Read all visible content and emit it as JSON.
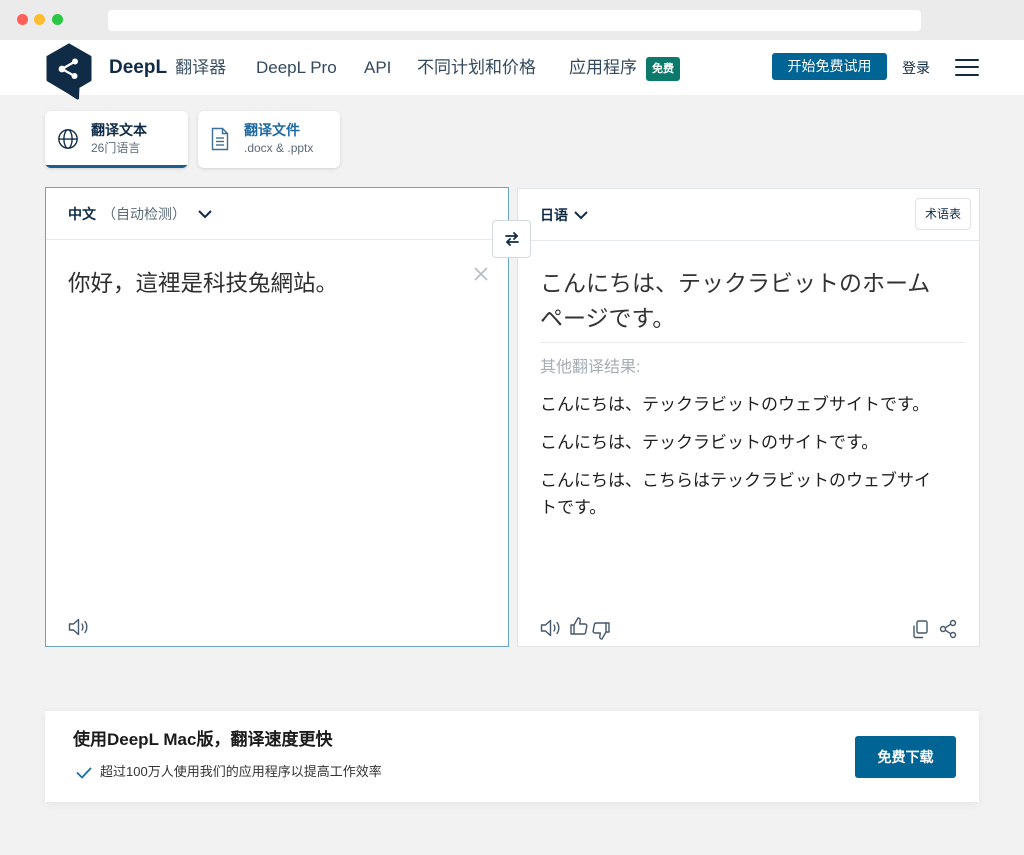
{
  "colors": {
    "brand_navy": "#0f2b46",
    "accent_blue": "#006494",
    "badge_green": "#0b7a6c",
    "focus_border": "#6aa3c9",
    "page_bg": "#f2f2f2"
  },
  "header": {
    "logo_icon": "deepl-logo-icon",
    "brand": "DeepL",
    "product": "翻译器",
    "nav": [
      {
        "label": "DeepL Pro"
      },
      {
        "label": "API"
      },
      {
        "label": "不同计划和价格"
      },
      {
        "label": "应用程序",
        "badge": "免费"
      }
    ],
    "cta_label": "开始免费试用",
    "login_label": "登录",
    "menu_icon": "hamburger-icon"
  },
  "tabs": [
    {
      "title": "翻译文本",
      "subtitle": "26门语言",
      "icon": "globe-icon",
      "active": true
    },
    {
      "title": "翻译文件",
      "subtitle": ".docx & .pptx",
      "icon": "document-icon",
      "active": false
    }
  ],
  "source": {
    "language": "中文",
    "detect_note": "（自动检测）",
    "text": "你好，這裡是科技兔網站。",
    "icons": [
      "chevron-down-icon",
      "clear-icon",
      "speaker-icon"
    ]
  },
  "swap_icon": "swap-languages-icon",
  "target": {
    "language": "日语",
    "glossary_label": "术语表",
    "text": "こんにちは、テックラビットのホームページです。",
    "alternatives_label": "其他翻译结果:",
    "alternatives": [
      "こんにちは、テックラビットのウェブサイトです。",
      "こんにちは、テックラビットのサイトです。",
      "こんにちは、こちらはテックラビットのウェブサイトです。"
    ],
    "icons": [
      "chevron-down-icon",
      "speaker-icon",
      "thumbs-up-icon",
      "thumbs-down-icon",
      "copy-icon",
      "share-icon"
    ]
  },
  "banner": {
    "title": "使用DeepL Mac版，翻译速度更快",
    "check_icon": "checkmark-icon",
    "subtitle": "超过100万人使用我们的应用程序以提高工作效率",
    "button_label": "免费下载"
  }
}
